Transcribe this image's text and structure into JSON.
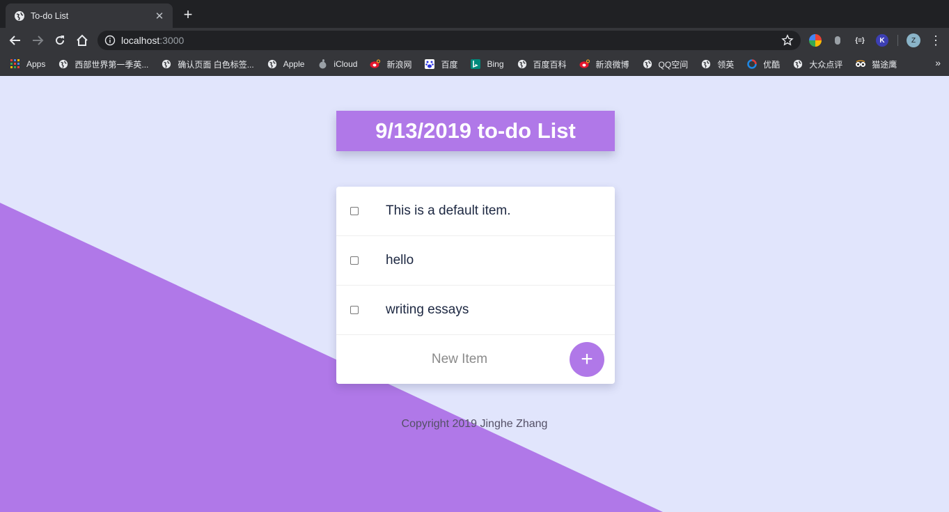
{
  "browser": {
    "tab": {
      "title": "To-do List",
      "close": "✕"
    },
    "new_tab": "+",
    "address": {
      "host": "localhost",
      "port": ":3000"
    },
    "profile_initial": "Z",
    "bookmarks": [
      {
        "label": "Apps",
        "icon": "apps-grid-icon"
      },
      {
        "label": "西部世界第一季英...",
        "icon": "globe-icon"
      },
      {
        "label": "确认页面 白色标签...",
        "icon": "globe-icon"
      },
      {
        "label": "Apple",
        "icon": "globe-icon"
      },
      {
        "label": "iCloud",
        "icon": "apple-icon"
      },
      {
        "label": "新浪网",
        "icon": "weibo-icon"
      },
      {
        "label": "百度",
        "icon": "baidu-icon"
      },
      {
        "label": "Bing",
        "icon": "bing-icon"
      },
      {
        "label": "百度百科",
        "icon": "globe-icon"
      },
      {
        "label": "新浪微博",
        "icon": "weibo-icon"
      },
      {
        "label": "QQ空间",
        "icon": "globe-icon"
      },
      {
        "label": "领英",
        "icon": "globe-icon"
      },
      {
        "label": "优酷",
        "icon": "youku-icon"
      },
      {
        "label": "大众点评",
        "icon": "globe-icon"
      },
      {
        "label": "猫途鹰",
        "icon": "tripadvisor-icon"
      }
    ],
    "more": "»"
  },
  "page": {
    "title": "9/13/2019 to-do List",
    "items": [
      {
        "text": "This is a default item.",
        "checked": false
      },
      {
        "text": "hello",
        "checked": false
      },
      {
        "text": "writing essays",
        "checked": false
      }
    ],
    "new_item_placeholder": "New Item",
    "add_button": "+",
    "footer": "Copyright 2019 Jinghe Zhang"
  },
  "colors": {
    "accent": "#b078e8",
    "page_background": "#e1e5fc",
    "item_text": "#1c2741"
  }
}
